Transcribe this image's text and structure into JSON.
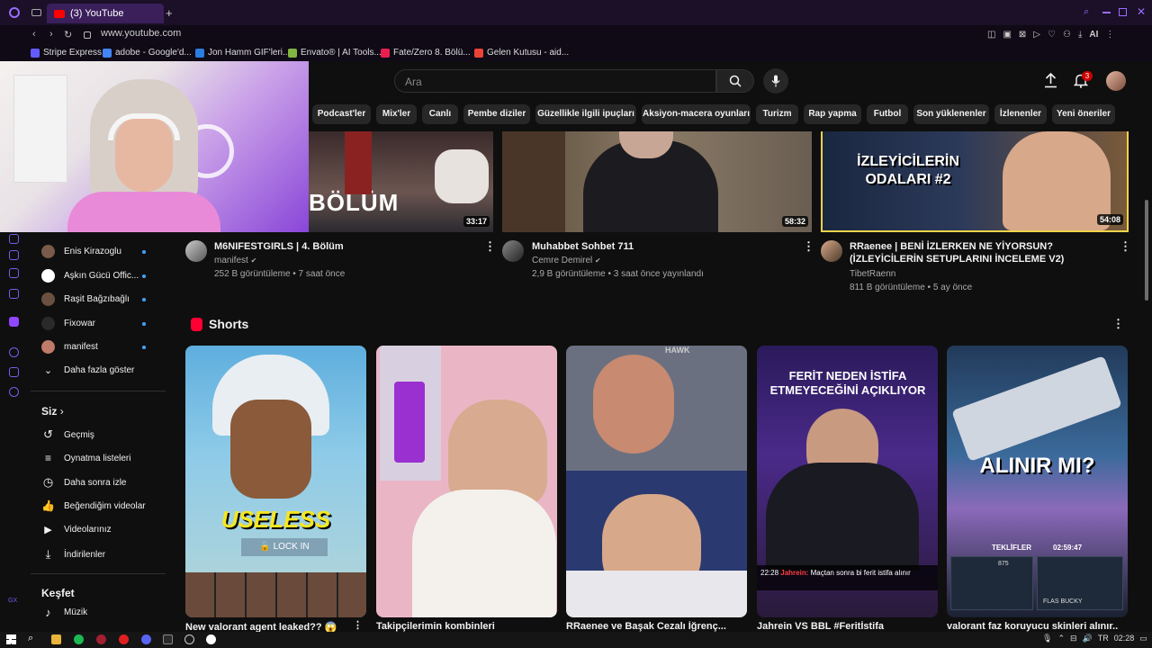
{
  "browser": {
    "tab_title": "(3) YouTube",
    "url": "www.youtube.com",
    "ai_label": "AI",
    "bookmarks": [
      {
        "label": "Stripe Express",
        "color": "#635bff"
      },
      {
        "label": "adobe - Google'd...",
        "color": "#4285f4"
      },
      {
        "label": "Jon Hamm GIF'leri...",
        "color": "#2a7de1"
      },
      {
        "label": "Envato® | AI Tools...",
        "color": "#82b541"
      },
      {
        "label": "Fate/Zero 8. Bölü...",
        "color": "#e81e4d"
      },
      {
        "label": "Gelen Kutusu - aid...",
        "color": "#ea4335"
      }
    ]
  },
  "header": {
    "search_placeholder": "Ara",
    "notification_count": "3"
  },
  "chips": [
    "Podcast'ler",
    "Mix'ler",
    "Canlı",
    "Pembe diziler",
    "Güzellikle ilgili ipuçları",
    "Aksiyon-macera oyunları",
    "Turizm",
    "Rap yapma",
    "Futbol",
    "Son yüklenenler",
    "İzlenenler",
    "Yeni öneriler"
  ],
  "sidebar": {
    "subscriptions": [
      {
        "label": "Enis Kirazoglu",
        "color": "#7a5a4a"
      },
      {
        "label": "Aşkın Gücü Offic...",
        "color": "#ffffff"
      },
      {
        "label": "Raşit Bağzıbağlı",
        "color": "#6a5040"
      },
      {
        "label": "Fixowar",
        "color": "#2a2a2a"
      },
      {
        "label": "manifest",
        "color": "#c07a6a"
      }
    ],
    "show_more": "Daha fazla göster",
    "you_section": "Siz",
    "you_items": [
      "Geçmiş",
      "Oynatma listeleri",
      "Daha sonra izle",
      "Beğendiğim videolar",
      "Videolarınız",
      "İndirilenler"
    ],
    "explore_section": "Keşfet",
    "explore_items": [
      "Müzik"
    ]
  },
  "videos": [
    {
      "title": "M6NIFESTGIRLS | 4. Bölüm",
      "channel": "manifest",
      "meta": "252 B görüntüleme • 7 saat önce",
      "duration": "33:17",
      "overlay": "BÖLÜM"
    },
    {
      "title": "Muhabbet Sohbet 711",
      "channel": "Cemre Demirel",
      "meta": "2,9 B görüntüleme • 3 saat önce yayınlandı",
      "duration": "58:32"
    },
    {
      "title": "RRaenee | BENİ İZLERKEN NE YİYORSUN? (İZLEYİCİLERİN SETUPLARINI İNCELEME V2)",
      "channel": "TibetRaenn",
      "meta": "811 B görüntüleme • 5 ay önce",
      "duration": "54:08",
      "overlay": "İZLEYİCİLERİN ODALARI #2"
    }
  ],
  "shorts": {
    "heading": "Shorts",
    "items": [
      {
        "title": "New valorant agent leaked?? 😱",
        "overlay": "USELESS",
        "sub_overlay": "🔒 LOCK IN"
      },
      {
        "title": "Takipçilerimin kombinleri"
      },
      {
        "title": "RRaenee ve Başak Cezalı İğrenç..."
      },
      {
        "title": "Jahrein VS BBL #Feritİstifa",
        "overlay": "FERİT NEDEN İSTİFA ETMEYECEĞİNİ AÇIKLIYOR",
        "chat_time": "22:28",
        "chat_user": "Jahrein:",
        "chat_text": "Maçtan sonra bi ferit istifa alınır"
      },
      {
        "title": "valorant faz koruyucu skinleri alınır...",
        "overlay": "ALINIR MI?",
        "ui_label": "TEKLİFLER",
        "ui_timer": "02:59:47",
        "price": "875",
        "item_label": "FLAS BUCKY"
      }
    ]
  },
  "taskbar": {
    "lang": "TR",
    "time": "02:28"
  }
}
